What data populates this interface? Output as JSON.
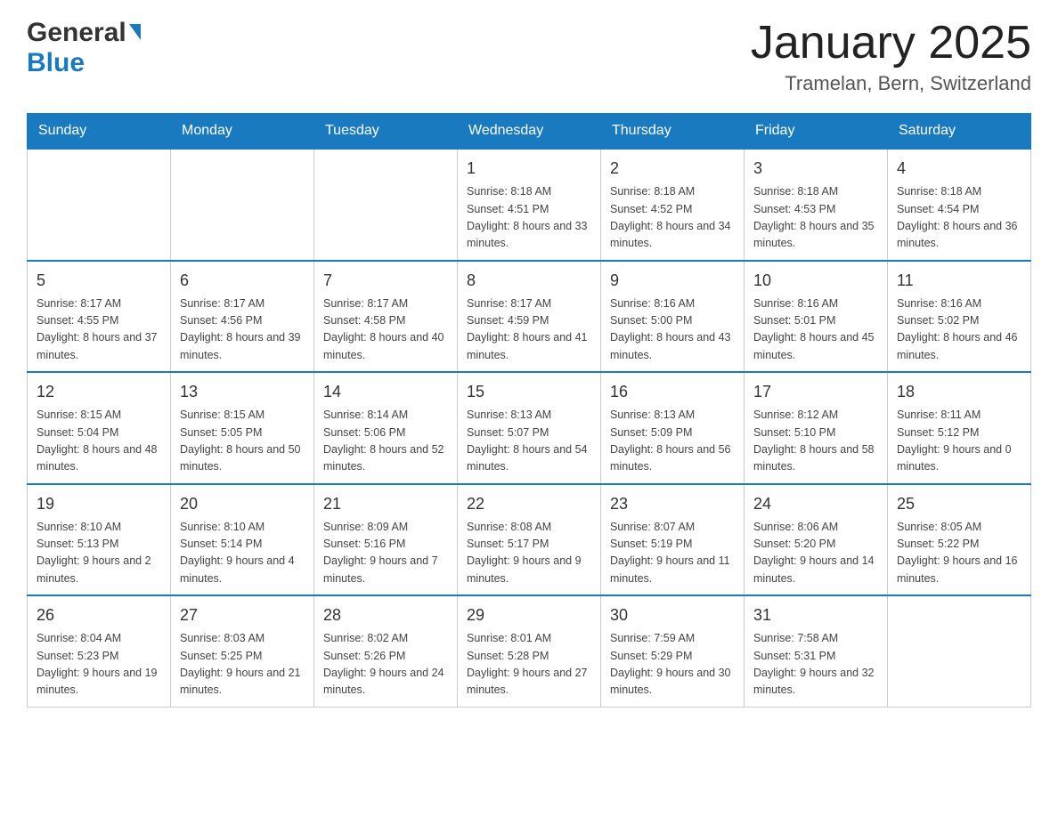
{
  "header": {
    "logo_general": "General",
    "logo_blue": "Blue",
    "title": "January 2025",
    "subtitle": "Tramelan, Bern, Switzerland"
  },
  "calendar": {
    "days": [
      "Sunday",
      "Monday",
      "Tuesday",
      "Wednesday",
      "Thursday",
      "Friday",
      "Saturday"
    ],
    "weeks": [
      [
        {
          "number": "",
          "info": ""
        },
        {
          "number": "",
          "info": ""
        },
        {
          "number": "",
          "info": ""
        },
        {
          "number": "1",
          "info": "Sunrise: 8:18 AM\nSunset: 4:51 PM\nDaylight: 8 hours\nand 33 minutes."
        },
        {
          "number": "2",
          "info": "Sunrise: 8:18 AM\nSunset: 4:52 PM\nDaylight: 8 hours\nand 34 minutes."
        },
        {
          "number": "3",
          "info": "Sunrise: 8:18 AM\nSunset: 4:53 PM\nDaylight: 8 hours\nand 35 minutes."
        },
        {
          "number": "4",
          "info": "Sunrise: 8:18 AM\nSunset: 4:54 PM\nDaylight: 8 hours\nand 36 minutes."
        }
      ],
      [
        {
          "number": "5",
          "info": "Sunrise: 8:17 AM\nSunset: 4:55 PM\nDaylight: 8 hours\nand 37 minutes."
        },
        {
          "number": "6",
          "info": "Sunrise: 8:17 AM\nSunset: 4:56 PM\nDaylight: 8 hours\nand 39 minutes."
        },
        {
          "number": "7",
          "info": "Sunrise: 8:17 AM\nSunset: 4:58 PM\nDaylight: 8 hours\nand 40 minutes."
        },
        {
          "number": "8",
          "info": "Sunrise: 8:17 AM\nSunset: 4:59 PM\nDaylight: 8 hours\nand 41 minutes."
        },
        {
          "number": "9",
          "info": "Sunrise: 8:16 AM\nSunset: 5:00 PM\nDaylight: 8 hours\nand 43 minutes."
        },
        {
          "number": "10",
          "info": "Sunrise: 8:16 AM\nSunset: 5:01 PM\nDaylight: 8 hours\nand 45 minutes."
        },
        {
          "number": "11",
          "info": "Sunrise: 8:16 AM\nSunset: 5:02 PM\nDaylight: 8 hours\nand 46 minutes."
        }
      ],
      [
        {
          "number": "12",
          "info": "Sunrise: 8:15 AM\nSunset: 5:04 PM\nDaylight: 8 hours\nand 48 minutes."
        },
        {
          "number": "13",
          "info": "Sunrise: 8:15 AM\nSunset: 5:05 PM\nDaylight: 8 hours\nand 50 minutes."
        },
        {
          "number": "14",
          "info": "Sunrise: 8:14 AM\nSunset: 5:06 PM\nDaylight: 8 hours\nand 52 minutes."
        },
        {
          "number": "15",
          "info": "Sunrise: 8:13 AM\nSunset: 5:07 PM\nDaylight: 8 hours\nand 54 minutes."
        },
        {
          "number": "16",
          "info": "Sunrise: 8:13 AM\nSunset: 5:09 PM\nDaylight: 8 hours\nand 56 minutes."
        },
        {
          "number": "17",
          "info": "Sunrise: 8:12 AM\nSunset: 5:10 PM\nDaylight: 8 hours\nand 58 minutes."
        },
        {
          "number": "18",
          "info": "Sunrise: 8:11 AM\nSunset: 5:12 PM\nDaylight: 9 hours\nand 0 minutes."
        }
      ],
      [
        {
          "number": "19",
          "info": "Sunrise: 8:10 AM\nSunset: 5:13 PM\nDaylight: 9 hours\nand 2 minutes."
        },
        {
          "number": "20",
          "info": "Sunrise: 8:10 AM\nSunset: 5:14 PM\nDaylight: 9 hours\nand 4 minutes."
        },
        {
          "number": "21",
          "info": "Sunrise: 8:09 AM\nSunset: 5:16 PM\nDaylight: 9 hours\nand 7 minutes."
        },
        {
          "number": "22",
          "info": "Sunrise: 8:08 AM\nSunset: 5:17 PM\nDaylight: 9 hours\nand 9 minutes."
        },
        {
          "number": "23",
          "info": "Sunrise: 8:07 AM\nSunset: 5:19 PM\nDaylight: 9 hours\nand 11 minutes."
        },
        {
          "number": "24",
          "info": "Sunrise: 8:06 AM\nSunset: 5:20 PM\nDaylight: 9 hours\nand 14 minutes."
        },
        {
          "number": "25",
          "info": "Sunrise: 8:05 AM\nSunset: 5:22 PM\nDaylight: 9 hours\nand 16 minutes."
        }
      ],
      [
        {
          "number": "26",
          "info": "Sunrise: 8:04 AM\nSunset: 5:23 PM\nDaylight: 9 hours\nand 19 minutes."
        },
        {
          "number": "27",
          "info": "Sunrise: 8:03 AM\nSunset: 5:25 PM\nDaylight: 9 hours\nand 21 minutes."
        },
        {
          "number": "28",
          "info": "Sunrise: 8:02 AM\nSunset: 5:26 PM\nDaylight: 9 hours\nand 24 minutes."
        },
        {
          "number": "29",
          "info": "Sunrise: 8:01 AM\nSunset: 5:28 PM\nDaylight: 9 hours\nand 27 minutes."
        },
        {
          "number": "30",
          "info": "Sunrise: 7:59 AM\nSunset: 5:29 PM\nDaylight: 9 hours\nand 30 minutes."
        },
        {
          "number": "31",
          "info": "Sunrise: 7:58 AM\nSunset: 5:31 PM\nDaylight: 9 hours\nand 32 minutes."
        },
        {
          "number": "",
          "info": ""
        }
      ]
    ]
  }
}
